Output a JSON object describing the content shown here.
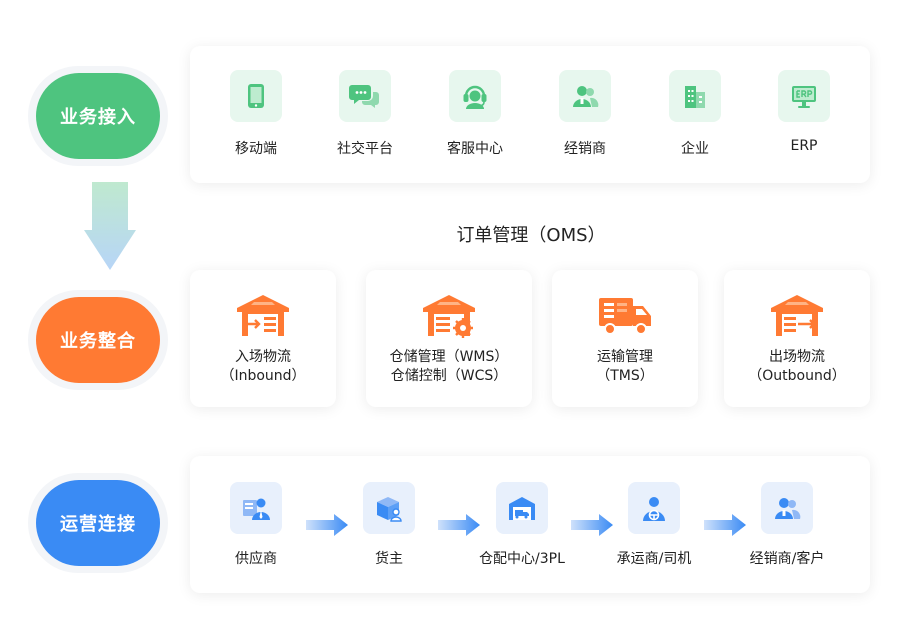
{
  "stages": {
    "access": "业务接入",
    "integration": "业务整合",
    "operations": "运营连接"
  },
  "channels": [
    {
      "label": "移动端",
      "icon": "tablet-icon"
    },
    {
      "label": "社交平台",
      "icon": "chat-icon"
    },
    {
      "label": "客服中心",
      "icon": "headset-icon"
    },
    {
      "label": "经销商",
      "icon": "people-icon"
    },
    {
      "label": "企业",
      "icon": "building-icon"
    },
    {
      "label": "ERP",
      "icon": "erp-monitor-icon"
    }
  ],
  "oms_title": "订单管理（OMS）",
  "modules": [
    {
      "line1": "入场物流",
      "line2": "（Inbound）",
      "icon": "warehouse-inbound-icon"
    },
    {
      "line1": "仓储管理（WMS）",
      "line2": "仓储控制（WCS）",
      "icon": "warehouse-gear-icon"
    },
    {
      "line1": "运输管理",
      "line2": "（TMS）",
      "icon": "truck-icon"
    },
    {
      "line1": "出场物流",
      "line2": "（Outbound）",
      "icon": "warehouse-outbound-icon"
    }
  ],
  "parties": [
    {
      "label": "供应商",
      "icon": "supplier-icon"
    },
    {
      "label": "货主",
      "icon": "cargo-owner-icon"
    },
    {
      "label": "仓配中心/3PL",
      "icon": "warehouse-truck-icon"
    },
    {
      "label": "承运商/司机",
      "icon": "driver-icon"
    },
    {
      "label": "经销商/客户",
      "icon": "customer-icon"
    }
  ],
  "colors": {
    "green": "#4ec47f",
    "orange": "#ff7a33",
    "blue": "#3a8bf4"
  }
}
